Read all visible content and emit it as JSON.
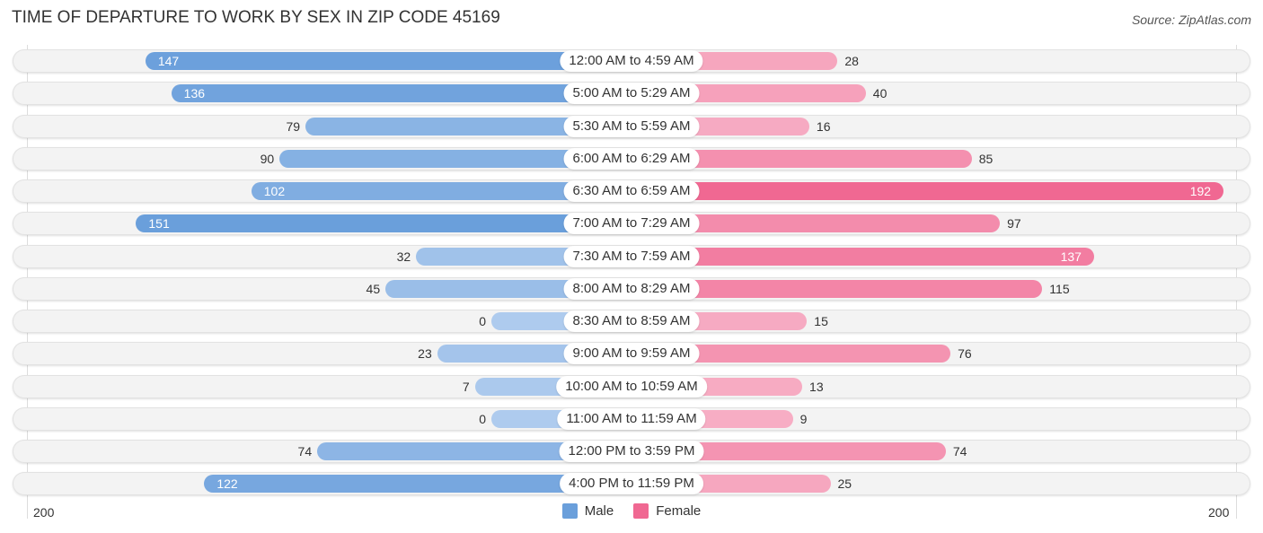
{
  "title": "TIME OF DEPARTURE TO WORK BY SEX IN ZIP CODE 45169",
  "source": "Source: ZipAtlas.com",
  "colors": {
    "male": "#6a9fdb",
    "female": "#f06892"
  },
  "chart_data": {
    "type": "bar",
    "orientation": "horizontal-diverging",
    "title": "TIME OF DEPARTURE TO WORK BY SEX IN ZIP CODE 45169",
    "categories": [
      "12:00 AM to 4:59 AM",
      "5:00 AM to 5:29 AM",
      "5:30 AM to 5:59 AM",
      "6:00 AM to 6:29 AM",
      "6:30 AM to 6:59 AM",
      "7:00 AM to 7:29 AM",
      "7:30 AM to 7:59 AM",
      "8:00 AM to 8:29 AM",
      "8:30 AM to 8:59 AM",
      "9:00 AM to 9:59 AM",
      "10:00 AM to 10:59 AM",
      "11:00 AM to 11:59 AM",
      "12:00 PM to 3:59 PM",
      "4:00 PM to 11:59 PM"
    ],
    "series": [
      {
        "name": "Male",
        "values": [
          147,
          136,
          79,
          90,
          102,
          151,
          32,
          45,
          0,
          23,
          7,
          0,
          74,
          122
        ]
      },
      {
        "name": "Female",
        "values": [
          28,
          40,
          16,
          85,
          192,
          97,
          137,
          115,
          15,
          76,
          13,
          9,
          74,
          25
        ]
      }
    ],
    "axis": {
      "left_tick": "200",
      "right_tick": "200",
      "range": [
        0,
        200
      ]
    },
    "legend": {
      "position": "bottom-center",
      "entries": [
        "Male",
        "Female"
      ]
    },
    "grid": false
  }
}
